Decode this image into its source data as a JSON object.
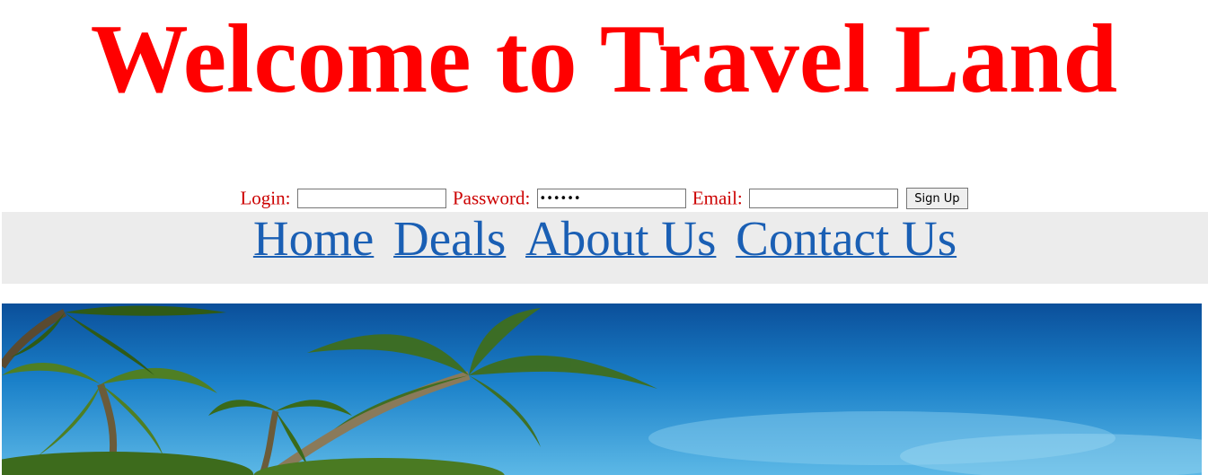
{
  "header": {
    "title": "Welcome to Travel Land"
  },
  "signup": {
    "login_label": "Login:",
    "login_value": "",
    "password_label": "Password:",
    "password_value": "••••••",
    "email_label": "Email:",
    "email_value": "",
    "submit_label": "Sign Up"
  },
  "nav": {
    "items": [
      {
        "label": "Home"
      },
      {
        "label": "Deals"
      },
      {
        "label": "About Us"
      },
      {
        "label": "Contact Us"
      }
    ]
  },
  "banner": {
    "image": "tropical-beach-palm-trees"
  },
  "colors": {
    "title": "#ff0000",
    "form_label": "#cc0000",
    "nav_link": "#1a5fb4",
    "nav_bg": "#ececec",
    "sky": "#1b7fc8"
  }
}
